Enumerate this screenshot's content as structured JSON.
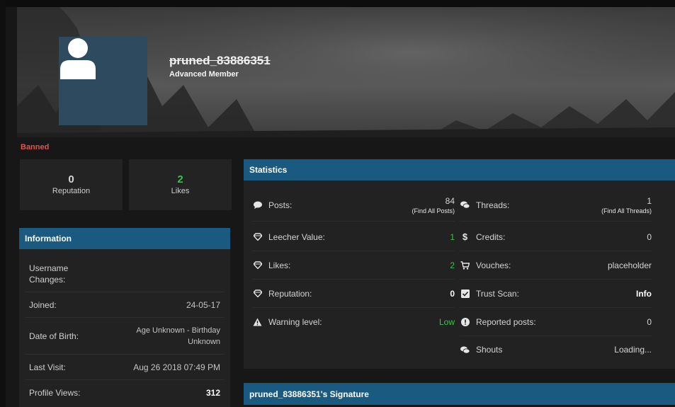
{
  "profile": {
    "username": "pruned_83886351",
    "user_title": "Advanced Member",
    "status": "Banned"
  },
  "summary": {
    "reputation": {
      "value": "0",
      "label": "Reputation"
    },
    "likes": {
      "value": "2",
      "label": "Likes"
    }
  },
  "information": {
    "title": "Information",
    "rows": [
      {
        "key": "Username Changes:",
        "value": ""
      },
      {
        "key": "Joined:",
        "value": "24-05-17"
      },
      {
        "key": "Date of Birth:",
        "value": "Age Unknown - Birthday Unknown"
      },
      {
        "key": "Last Visit:",
        "value": "Aug 26 2018 07:49 PM"
      },
      {
        "key": "Profile Views:",
        "value": "312"
      }
    ]
  },
  "statistics": {
    "title": "Statistics",
    "left": [
      {
        "icon": "speech-bubble-icon",
        "label": "Posts:",
        "value": "84",
        "sub": "(Find All Posts)"
      },
      {
        "icon": "diamond-icon",
        "label": "Leecher Value:",
        "value": "1"
      },
      {
        "icon": "diamond-icon",
        "label": "Likes:",
        "value": "2"
      },
      {
        "icon": "diamond-icon",
        "label": "Reputation:",
        "value": "0"
      },
      {
        "icon": "warning-icon",
        "label": "Warning level:",
        "value": "Low"
      }
    ],
    "right": [
      {
        "icon": "chat-bubbles-icon",
        "label": "Threads:",
        "value": "1",
        "sub": "(Find All Threads)"
      },
      {
        "icon": "dollar-icon",
        "label": "Credits:",
        "value": "0"
      },
      {
        "icon": "cart-icon",
        "label": "Vouches:",
        "value": "placeholder"
      },
      {
        "icon": "check-square-icon",
        "label": "Trust Scan:",
        "value": "Info"
      },
      {
        "icon": "exclamation-circle-icon",
        "label": "Reported posts:",
        "value": "0"
      },
      {
        "icon": "chat-bubbles-icon",
        "label": "Shouts",
        "value": "Loading..."
      }
    ]
  },
  "signature": {
    "title": "pruned_83886351's Signature"
  },
  "colors": {
    "accent": "#1b5a80",
    "positive": "#3fbf4e",
    "banned": "#e05353"
  }
}
